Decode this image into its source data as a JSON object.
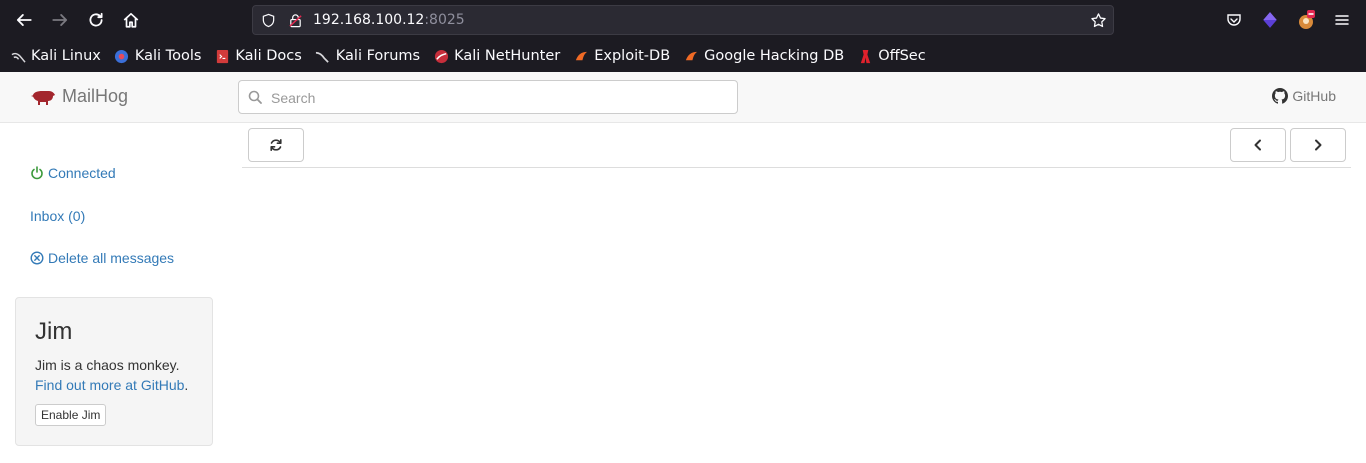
{
  "browser": {
    "url_host": "192.168.100.12",
    "url_port": ":8025",
    "bookmarks": [
      "Kali Linux",
      "Kali Tools",
      "Kali Docs",
      "Kali Forums",
      "Kali NetHunter",
      "Exploit-DB",
      "Google Hacking DB",
      "OffSec"
    ]
  },
  "app": {
    "brand": "MailHog",
    "search_placeholder": "Search",
    "github_label": "GitHub"
  },
  "sidebar": {
    "connected": "Connected",
    "inbox": "Inbox (0)",
    "delete_all": "Delete all messages"
  },
  "jim": {
    "title": "Jim",
    "description": "Jim is a chaos monkey.",
    "link_text": "Find out more at GitHub",
    "link_suffix": ".",
    "button": "Enable Jim"
  },
  "colors": {
    "link": "#337ab7",
    "connected": "#3c9a3c",
    "browser_bg": "#1c1b22"
  }
}
